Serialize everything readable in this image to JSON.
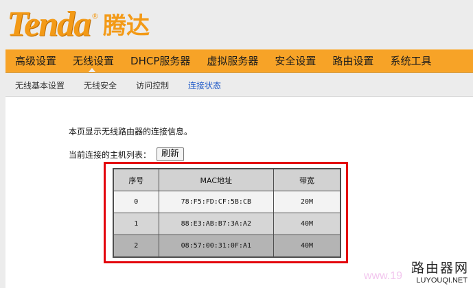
{
  "logo": {
    "brand": "Tenda",
    "reg": "®",
    "cn": "腾达"
  },
  "main_nav": [
    {
      "label": "高级设置"
    },
    {
      "label": "无线设置"
    },
    {
      "label": "DHCP服务器"
    },
    {
      "label": "虚拟服务器"
    },
    {
      "label": "安全设置"
    },
    {
      "label": "路由设置"
    },
    {
      "label": "系统工具"
    }
  ],
  "sub_nav": [
    {
      "label": "无线基本设置"
    },
    {
      "label": "无线安全"
    },
    {
      "label": "访问控制"
    },
    {
      "label": "连接状态"
    }
  ],
  "content": {
    "description": "本页显示无线路由器的连接信息。",
    "host_list_label": "当前连接的主机列表：",
    "refresh_label": "刷新"
  },
  "table": {
    "headers": [
      "序号",
      "MAC地址",
      "带宽"
    ],
    "rows": [
      [
        "0",
        "78:F5:FD:CF:5B:CB",
        "20M"
      ],
      [
        "1",
        "88:E3:AB:B7:3A:A2",
        "40M"
      ],
      [
        "2",
        "08:57:00:31:0F:A1",
        "40M"
      ]
    ]
  },
  "watermark": {
    "cn": "路由器网",
    "en": "LUYOUQI.NET",
    "faint": "www.19"
  },
  "colors": {
    "accent": "#f7a327",
    "highlight_box": "#e3000b",
    "active_sub": "#1a56c7"
  }
}
